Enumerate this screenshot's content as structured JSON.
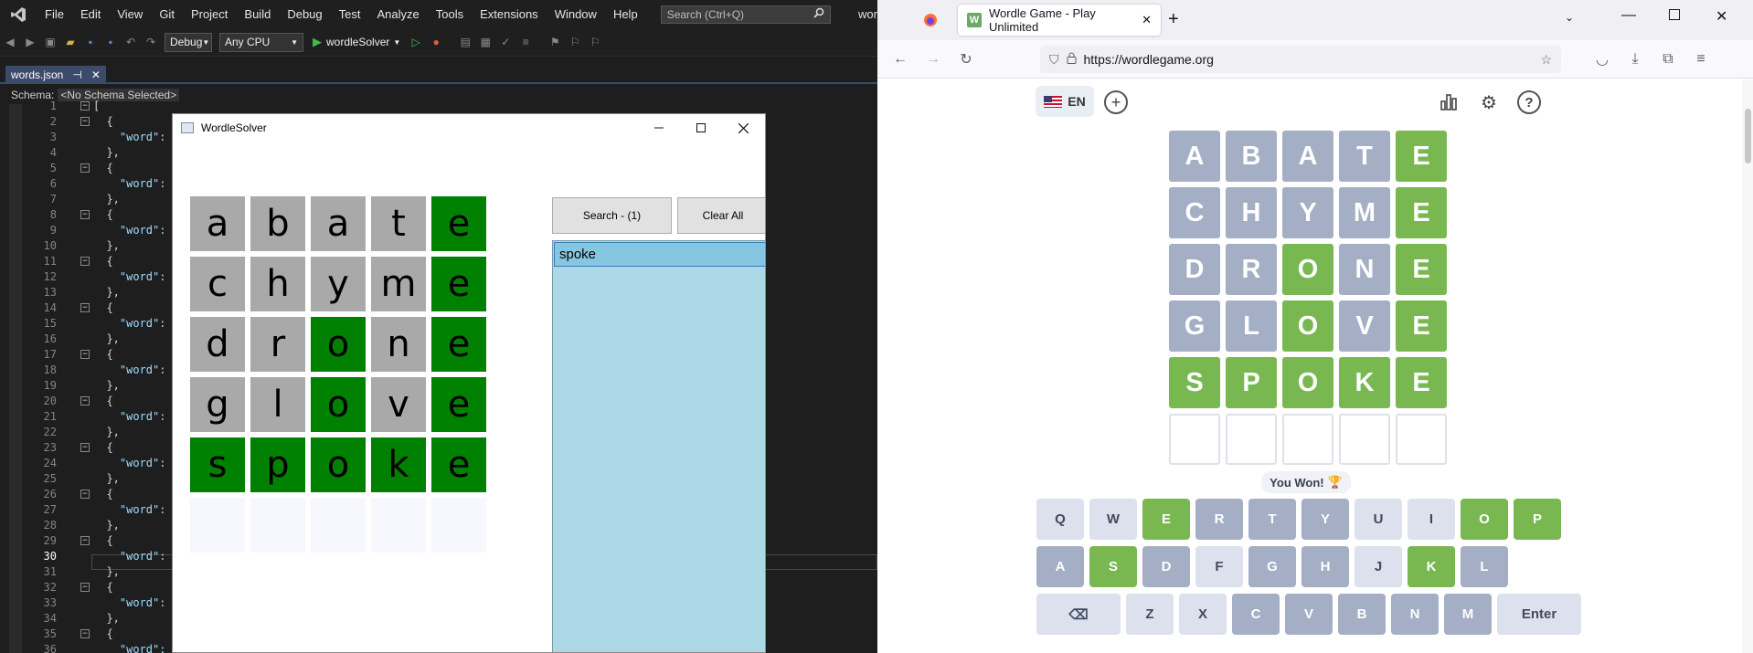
{
  "vs": {
    "menu": [
      "File",
      "Edit",
      "View",
      "Git",
      "Project",
      "Build",
      "Debug",
      "Test",
      "Analyze",
      "Tools",
      "Extensions",
      "Window",
      "Help"
    ],
    "search_placeholder": "Search (Ctrl+Q)",
    "solution_name": "wor",
    "toolbar": {
      "config": "Debug",
      "platform": "Any CPU",
      "run_target": "wordleSolver"
    },
    "tab": {
      "label": "words.json",
      "pin": "⊣",
      "close": "✕"
    },
    "schema_label": "Schema:",
    "schema_value": "<No Schema Selected>",
    "editor_lines": [
      {
        "n": "1",
        "code": "["
      },
      {
        "n": "2",
        "code": "  {"
      },
      {
        "n": "3",
        "code": "    \"word\":"
      },
      {
        "n": "4",
        "code": "  },"
      },
      {
        "n": "5",
        "code": "  {"
      },
      {
        "n": "6",
        "code": "    \"word\":"
      },
      {
        "n": "7",
        "code": "  },"
      },
      {
        "n": "8",
        "code": "  {"
      },
      {
        "n": "9",
        "code": "    \"word\":"
      },
      {
        "n": "10",
        "code": "  },"
      },
      {
        "n": "11",
        "code": "  {"
      },
      {
        "n": "12",
        "code": "    \"word\":"
      },
      {
        "n": "13",
        "code": "  },"
      },
      {
        "n": "14",
        "code": "  {"
      },
      {
        "n": "15",
        "code": "    \"word\":"
      },
      {
        "n": "16",
        "code": "  },"
      },
      {
        "n": "17",
        "code": "  {"
      },
      {
        "n": "18",
        "code": "    \"word\":"
      },
      {
        "n": "19",
        "code": "  },"
      },
      {
        "n": "20",
        "code": "  {"
      },
      {
        "n": "21",
        "code": "    \"word\":"
      },
      {
        "n": "22",
        "code": "  },"
      },
      {
        "n": "23",
        "code": "  {"
      },
      {
        "n": "24",
        "code": "    \"word\":"
      },
      {
        "n": "25",
        "code": "  },"
      },
      {
        "n": "26",
        "code": "  {"
      },
      {
        "n": "27",
        "code": "    \"word\":"
      },
      {
        "n": "28",
        "code": "  },"
      },
      {
        "n": "29",
        "code": "  {"
      },
      {
        "n": "30",
        "code": "    \"word\":"
      },
      {
        "n": "31",
        "code": "  },"
      },
      {
        "n": "32",
        "code": "  {"
      },
      {
        "n": "33",
        "code": "    \"word\":"
      },
      {
        "n": "34",
        "code": "  },"
      },
      {
        "n": "35",
        "code": "  {"
      },
      {
        "n": "36",
        "code": "    \"word\":"
      }
    ],
    "current_line": "30"
  },
  "solver": {
    "title": "WordleSolver",
    "search_button": "Search - (1)",
    "clear_button": "Clear All",
    "results": [
      "spoke"
    ],
    "grid": [
      [
        {
          "l": "a",
          "s": "absent"
        },
        {
          "l": "b",
          "s": "absent"
        },
        {
          "l": "a",
          "s": "absent"
        },
        {
          "l": "t",
          "s": "absent"
        },
        {
          "l": "e",
          "s": "correct"
        }
      ],
      [
        {
          "l": "c",
          "s": "absent"
        },
        {
          "l": "h",
          "s": "absent"
        },
        {
          "l": "y",
          "s": "absent"
        },
        {
          "l": "m",
          "s": "absent"
        },
        {
          "l": "e",
          "s": "correct"
        }
      ],
      [
        {
          "l": "d",
          "s": "absent"
        },
        {
          "l": "r",
          "s": "absent"
        },
        {
          "l": "o",
          "s": "correct"
        },
        {
          "l": "n",
          "s": "absent"
        },
        {
          "l": "e",
          "s": "correct"
        }
      ],
      [
        {
          "l": "g",
          "s": "absent"
        },
        {
          "l": "l",
          "s": "absent"
        },
        {
          "l": "o",
          "s": "correct"
        },
        {
          "l": "v",
          "s": "absent"
        },
        {
          "l": "e",
          "s": "correct"
        }
      ],
      [
        {
          "l": "s",
          "s": "correct"
        },
        {
          "l": "p",
          "s": "correct"
        },
        {
          "l": "o",
          "s": "correct"
        },
        {
          "l": "k",
          "s": "correct"
        },
        {
          "l": "e",
          "s": "correct"
        }
      ],
      [
        {
          "l": "",
          "s": "empty"
        },
        {
          "l": "",
          "s": "empty"
        },
        {
          "l": "",
          "s": "empty"
        },
        {
          "l": "",
          "s": "empty"
        },
        {
          "l": "",
          "s": "empty"
        }
      ]
    ]
  },
  "browser": {
    "tab_title": "Wordle Game - Play Unlimited",
    "favicon_letter": "W",
    "url": "https://wordlegame.org",
    "lang": "EN",
    "message": "You Won!",
    "trophy": "🏆",
    "board": [
      [
        {
          "l": "A",
          "s": "absent"
        },
        {
          "l": "B",
          "s": "absent"
        },
        {
          "l": "A",
          "s": "absent"
        },
        {
          "l": "T",
          "s": "absent"
        },
        {
          "l": "E",
          "s": "correct"
        }
      ],
      [
        {
          "l": "C",
          "s": "absent"
        },
        {
          "l": "H",
          "s": "absent"
        },
        {
          "l": "Y",
          "s": "absent"
        },
        {
          "l": "M",
          "s": "absent"
        },
        {
          "l": "E",
          "s": "correct"
        }
      ],
      [
        {
          "l": "D",
          "s": "absent"
        },
        {
          "l": "R",
          "s": "absent"
        },
        {
          "l": "O",
          "s": "correct"
        },
        {
          "l": "N",
          "s": "absent"
        },
        {
          "l": "E",
          "s": "correct"
        }
      ],
      [
        {
          "l": "G",
          "s": "absent"
        },
        {
          "l": "L",
          "s": "absent"
        },
        {
          "l": "O",
          "s": "correct"
        },
        {
          "l": "V",
          "s": "absent"
        },
        {
          "l": "E",
          "s": "correct"
        }
      ],
      [
        {
          "l": "S",
          "s": "correct"
        },
        {
          "l": "P",
          "s": "correct"
        },
        {
          "l": "O",
          "s": "correct"
        },
        {
          "l": "K",
          "s": "correct"
        },
        {
          "l": "E",
          "s": "correct"
        }
      ],
      [
        {
          "l": "",
          "s": "empty"
        },
        {
          "l": "",
          "s": "empty"
        },
        {
          "l": "",
          "s": "empty"
        },
        {
          "l": "",
          "s": "empty"
        },
        {
          "l": "",
          "s": "empty"
        }
      ]
    ],
    "keyboard": [
      [
        {
          "k": "Q",
          "s": "unused"
        },
        {
          "k": "W",
          "s": "unused"
        },
        {
          "k": "E",
          "s": "correct"
        },
        {
          "k": "R",
          "s": "absent"
        },
        {
          "k": "T",
          "s": "absent"
        },
        {
          "k": "Y",
          "s": "absent"
        },
        {
          "k": "U",
          "s": "unused"
        },
        {
          "k": "I",
          "s": "unused"
        },
        {
          "k": "O",
          "s": "correct"
        },
        {
          "k": "P",
          "s": "correct"
        }
      ],
      [
        {
          "k": "A",
          "s": "absent"
        },
        {
          "k": "S",
          "s": "correct"
        },
        {
          "k": "D",
          "s": "absent"
        },
        {
          "k": "F",
          "s": "unused"
        },
        {
          "k": "G",
          "s": "absent"
        },
        {
          "k": "H",
          "s": "absent"
        },
        {
          "k": "J",
          "s": "unused"
        },
        {
          "k": "K",
          "s": "correct"
        },
        {
          "k": "L",
          "s": "absent"
        }
      ],
      [
        {
          "k": "⌫",
          "s": "unused",
          "wide": true,
          "name": "backspace-key"
        },
        {
          "k": "Z",
          "s": "unused"
        },
        {
          "k": "X",
          "s": "unused"
        },
        {
          "k": "C",
          "s": "absent"
        },
        {
          "k": "V",
          "s": "absent"
        },
        {
          "k": "B",
          "s": "absent"
        },
        {
          "k": "N",
          "s": "absent"
        },
        {
          "k": "M",
          "s": "absent"
        },
        {
          "k": "Enter",
          "s": "unused",
          "wide": true,
          "name": "enter-key"
        }
      ]
    ]
  },
  "colors": {
    "solver_absent": "#a9a9a9",
    "solver_correct": "#008000",
    "game_absent": "#a4aec4",
    "game_correct": "#79b851",
    "results_bg": "#add8e6"
  },
  "icons": [
    "vs-logo-icon",
    "search-icon",
    "firefox-icon",
    "back-icon",
    "forward-icon",
    "reload-icon",
    "shield-icon",
    "lock-icon",
    "bookmark-star-icon",
    "pocket-icon",
    "download-icon",
    "extensions-icon",
    "menu-icon",
    "add-icon",
    "stats-icon",
    "settings-icon",
    "help-icon"
  ]
}
